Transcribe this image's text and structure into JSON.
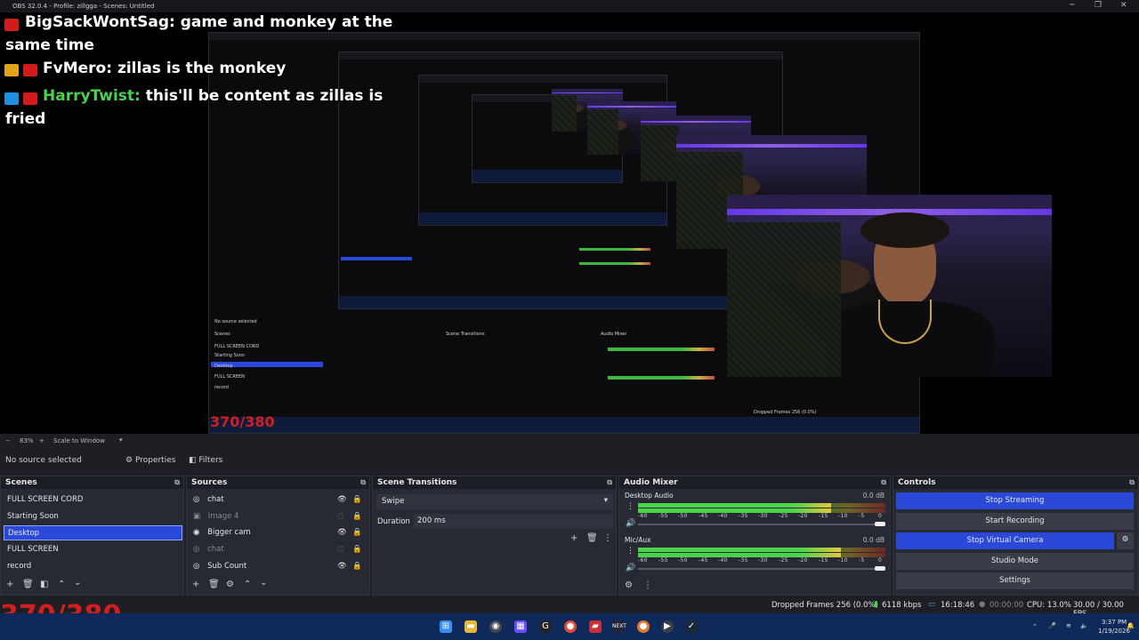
{
  "window": {
    "title": "OBS 32.0.4 - Profile: zillgga - Scenes: Untitled"
  },
  "chat_overlay": [
    {
      "user": "BigSackWontSag:",
      "message": "game and monkey at the",
      "message2": "same time",
      "user_color": "#ffffff"
    },
    {
      "user": "FvMero:",
      "message": "zillas is the monkey",
      "user_color": "#ffffff"
    },
    {
      "user": "HarryTwist:",
      "message": "this'll be content as zillas is",
      "message2": "fried",
      "user_color": "#49d24f"
    }
  ],
  "counter": {
    "large": "370/380",
    "preview": "370/380"
  },
  "preview_toolbar": {
    "zoom": "83%",
    "scale": "Scale to Window"
  },
  "source_toolbar": {
    "no_source": "No source selected",
    "properties": "Properties",
    "filters": "Filters"
  },
  "scenes": {
    "title": "Scenes",
    "items": [
      "FULL SCREEN CORD",
      "Starting Soon",
      "Desktop",
      "FULL SCREEN",
      "record"
    ],
    "selected_index": 2
  },
  "sources": {
    "title": "Sources",
    "items": [
      {
        "label": "chat",
        "visible": true
      },
      {
        "label": "Image 4",
        "visible": false
      },
      {
        "label": "Bigger cam",
        "visible": true
      },
      {
        "label": "chat",
        "visible": false
      },
      {
        "label": "Sub Count",
        "visible": true
      }
    ]
  },
  "transitions": {
    "title": "Scene Transitions",
    "selected": "Swipe",
    "duration_label": "Duration",
    "duration_value": "200 ms"
  },
  "audio_mixer": {
    "title": "Audio Mixer",
    "channels": [
      {
        "name": "Desktop Audio",
        "db": "0.0 dB",
        "level": 0.78
      },
      {
        "name": "Mic/Aux",
        "db": "0.0 dB",
        "level": 0.82
      }
    ],
    "scale": [
      "-60",
      "-55",
      "-50",
      "-45",
      "-40",
      "-35",
      "-30",
      "-25",
      "-20",
      "-15",
      "-10",
      "-5",
      "0"
    ]
  },
  "controls": {
    "title": "Controls",
    "buttons": [
      "Stop Streaming",
      "Start Recording",
      "Stop Virtual Camera",
      "Studio Mode",
      "Settings"
    ]
  },
  "status": {
    "dropped": "Dropped Frames 256 (0.0%)",
    "bitrate": "6118 kbps",
    "stream_time": "16:18:46",
    "rec_time": "00:00:00",
    "cpu": "CPU: 13.0%",
    "fps": "30.00 / 30.00 FPS"
  },
  "taskbar": {
    "time": "3:37 PM",
    "date": "1/19/2026"
  },
  "colors": {
    "accent": "#2b49d8",
    "dock_bg": "#272a33",
    "taskbar": "#0f2a5a",
    "counter_red": "#d11f1f"
  }
}
